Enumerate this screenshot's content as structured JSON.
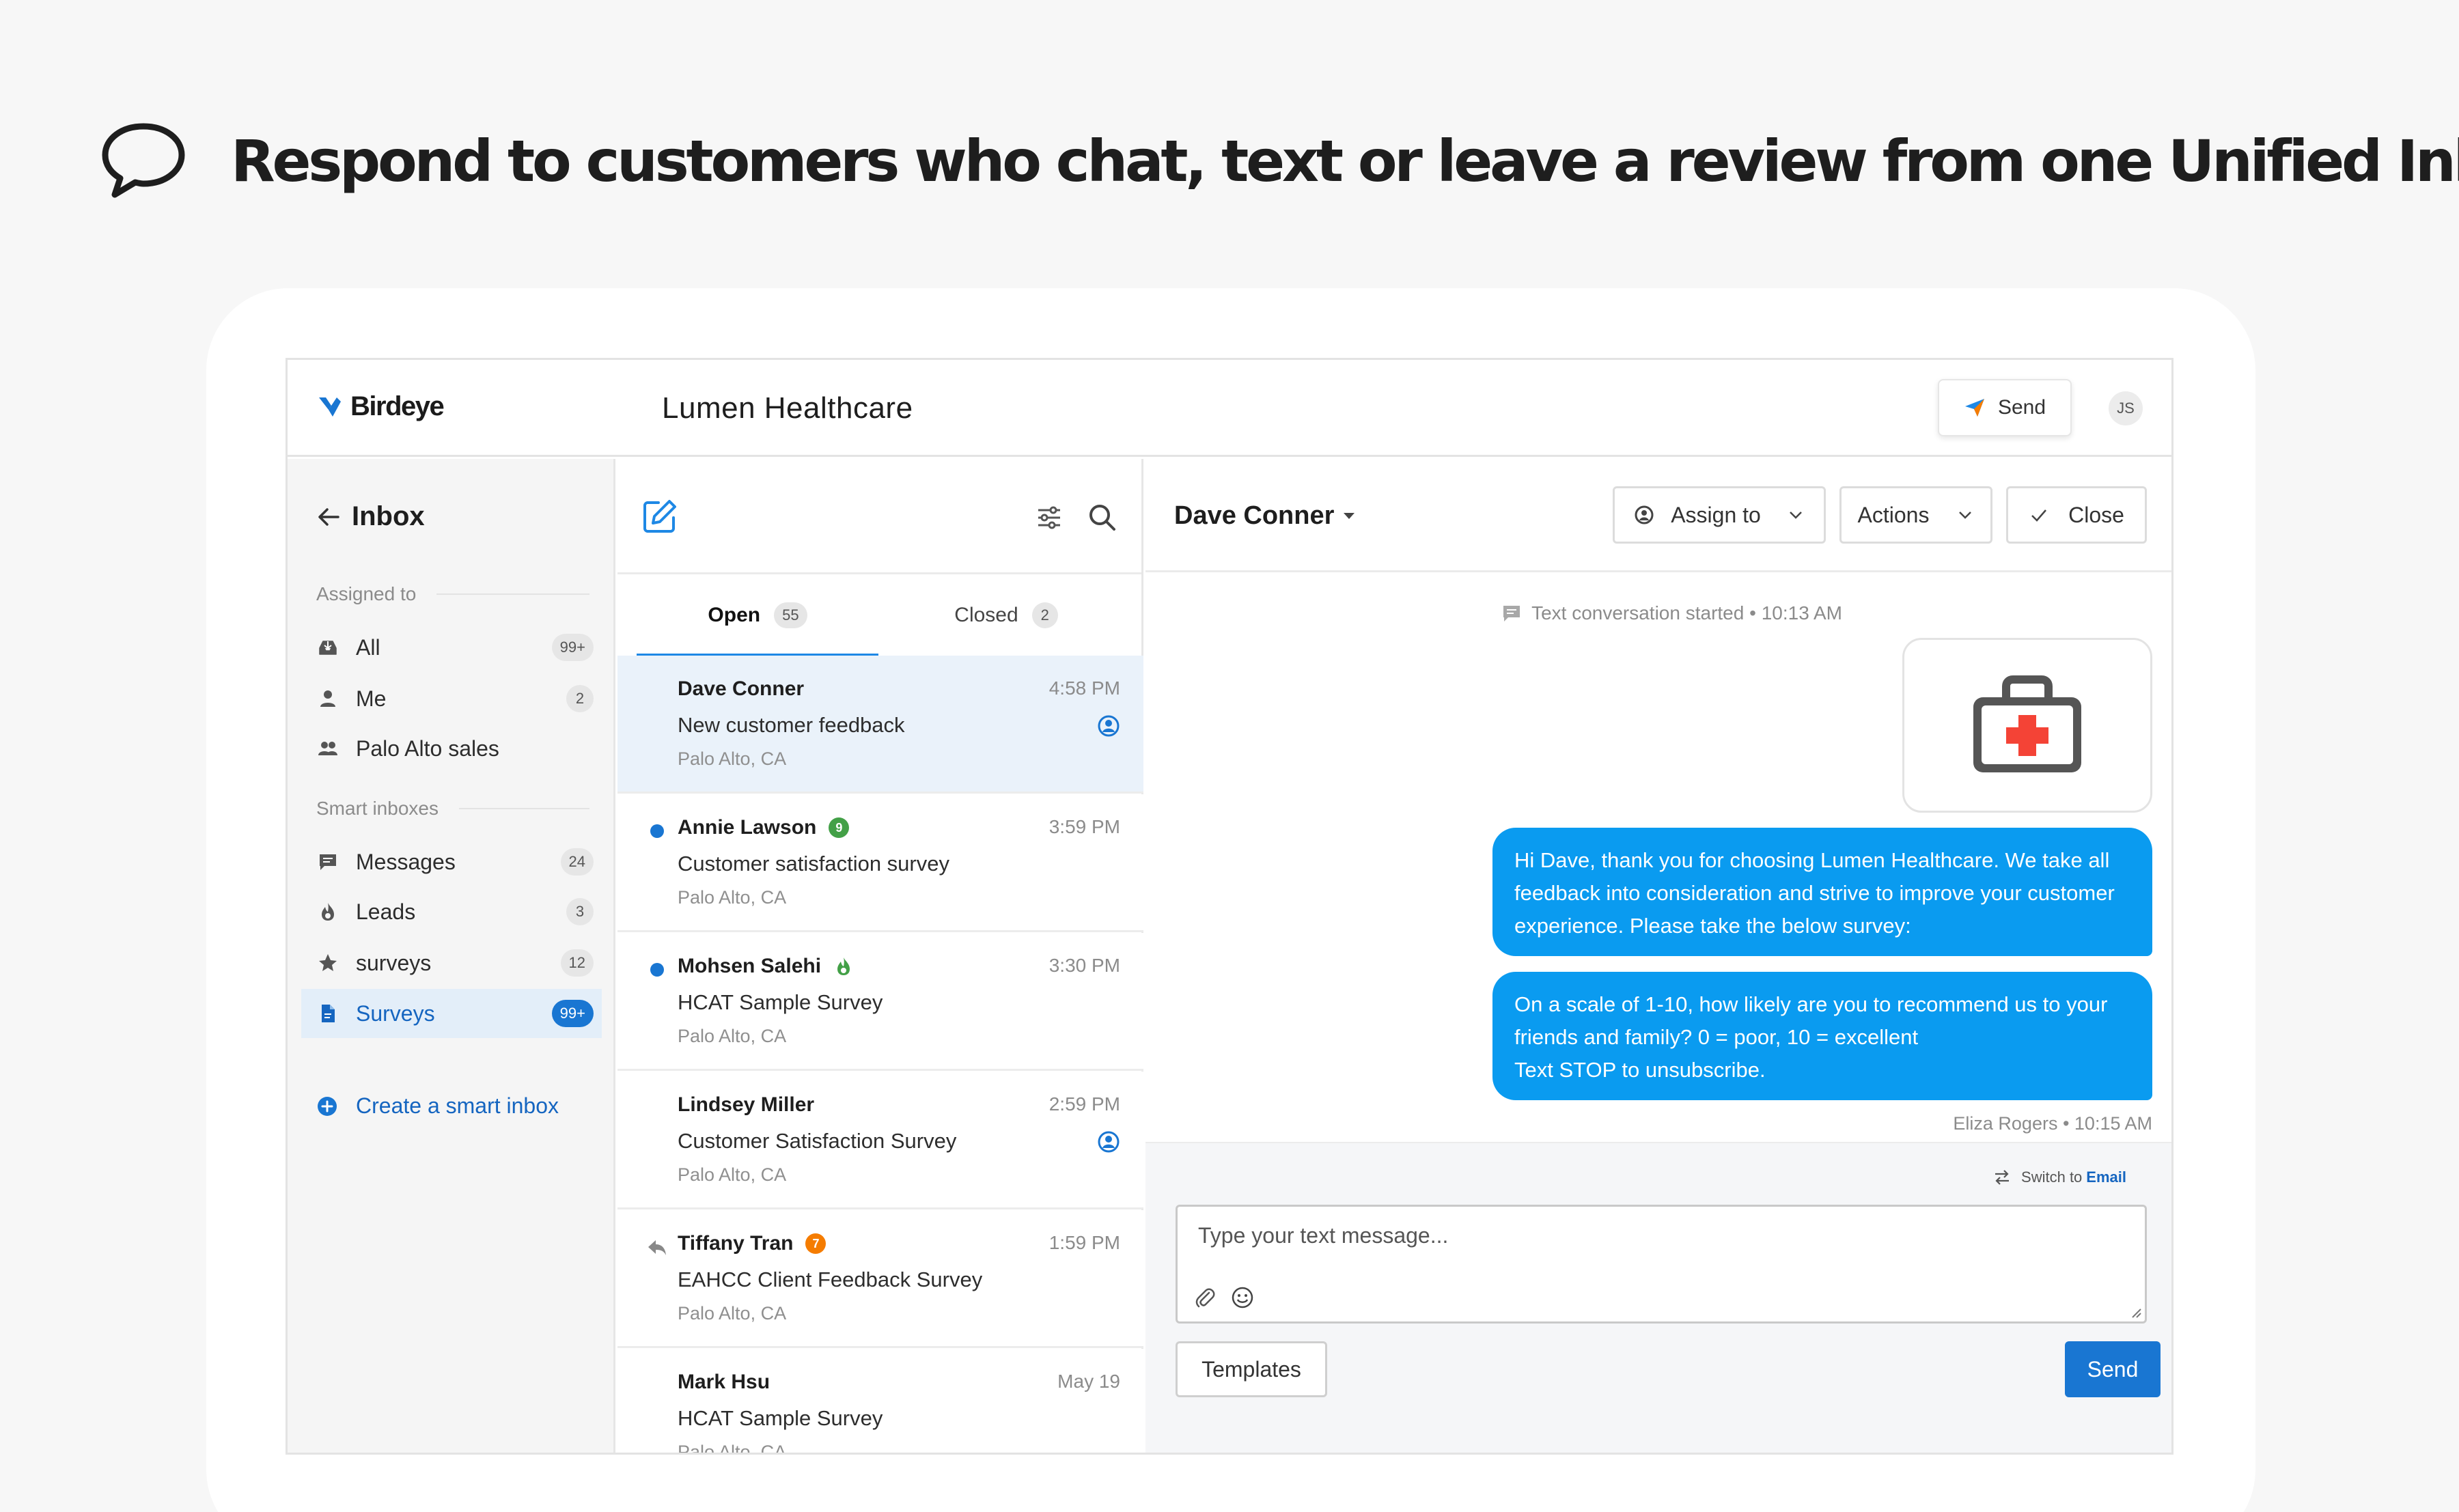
{
  "headline": {
    "text": "Respond to customers who chat, text or leave a review from one Unified Inbox"
  },
  "topbar": {
    "brand": "Birdeye",
    "business_name": "Lumen Healthcare",
    "send_label": "Send",
    "avatar_initials": "JS"
  },
  "nav": {
    "title": "Inbox",
    "section_assigned": "Assigned to",
    "section_smart": "Smart inboxes",
    "assigned": [
      {
        "label": "All",
        "count": "99+",
        "icon": "inbox-icon"
      },
      {
        "label": "Me",
        "count": "2",
        "icon": "person-icon"
      },
      {
        "label": "Palo Alto sales",
        "count": "",
        "icon": "group-icon"
      }
    ],
    "smart": [
      {
        "label": "Messages",
        "count": "24",
        "icon": "message-icon"
      },
      {
        "label": "Leads",
        "count": "3",
        "icon": "fire-icon"
      },
      {
        "label": "surveys",
        "count": "12",
        "icon": "star-icon"
      },
      {
        "label": "Surveys",
        "count": "99+",
        "icon": "document-icon",
        "selected": true
      }
    ],
    "create_label": "Create a smart inbox"
  },
  "list": {
    "tabs": [
      {
        "label": "Open",
        "count": "55",
        "active": true
      },
      {
        "label": "Closed",
        "count": "2",
        "active": false
      }
    ],
    "conversations": [
      {
        "name": "Dave Conner",
        "subject": "New customer feedback",
        "location": "Palo Alto, CA",
        "time": "4:58 PM"
      },
      {
        "name": "Annie Lawson",
        "subject": "Customer satisfaction survey",
        "location": "Palo Alto, CA",
        "time": "3:59 PM",
        "badge": "9"
      },
      {
        "name": "Mohsen Salehi",
        "subject": "HCAT Sample Survey",
        "location": "Palo Alto, CA",
        "time": "3:30 PM"
      },
      {
        "name": "Lindsey Miller",
        "subject": "Customer Satisfaction Survey",
        "location": "Palo Alto, CA",
        "time": "2:59 PM"
      },
      {
        "name": "Tiffany Tran",
        "subject": "EAHCC Client Feedback Survey",
        "location": "Palo Alto, CA",
        "time": "1:59 PM",
        "badge": "7"
      },
      {
        "name": "Mark Hsu",
        "subject": "HCAT Sample Survey",
        "location": "Palo Alto, CA",
        "time": "May 19"
      }
    ]
  },
  "chat": {
    "contact_name": "Dave Conner",
    "assign_label": "Assign to",
    "actions_label": "Actions",
    "close_label": "Close",
    "started_text": "Text conversation started • 10:13 AM",
    "messages": [
      "Hi Dave, thank you for choosing Lumen Healthcare. We take all feedback into consideration and strive to improve your customer experience. Please take the below survey:",
      "On a scale of 1-10, how likely are you to recommend us to your friends and family? 0 = poor, 10 = excellent\nText STOP to unsubscribe."
    ],
    "sender_meta": "Eliza Rogers • 10:15 AM",
    "switch_prefix": "Switch to",
    "switch_target": "Email",
    "input_placeholder": "Type your text message...",
    "templates_label": "Templates",
    "send_label": "Send"
  },
  "colors": {
    "brand_blue": "#1976d2",
    "bubble_blue": "#0a9bf0",
    "selected_row": "#eaf2fa",
    "medical_red": "#f44336"
  }
}
